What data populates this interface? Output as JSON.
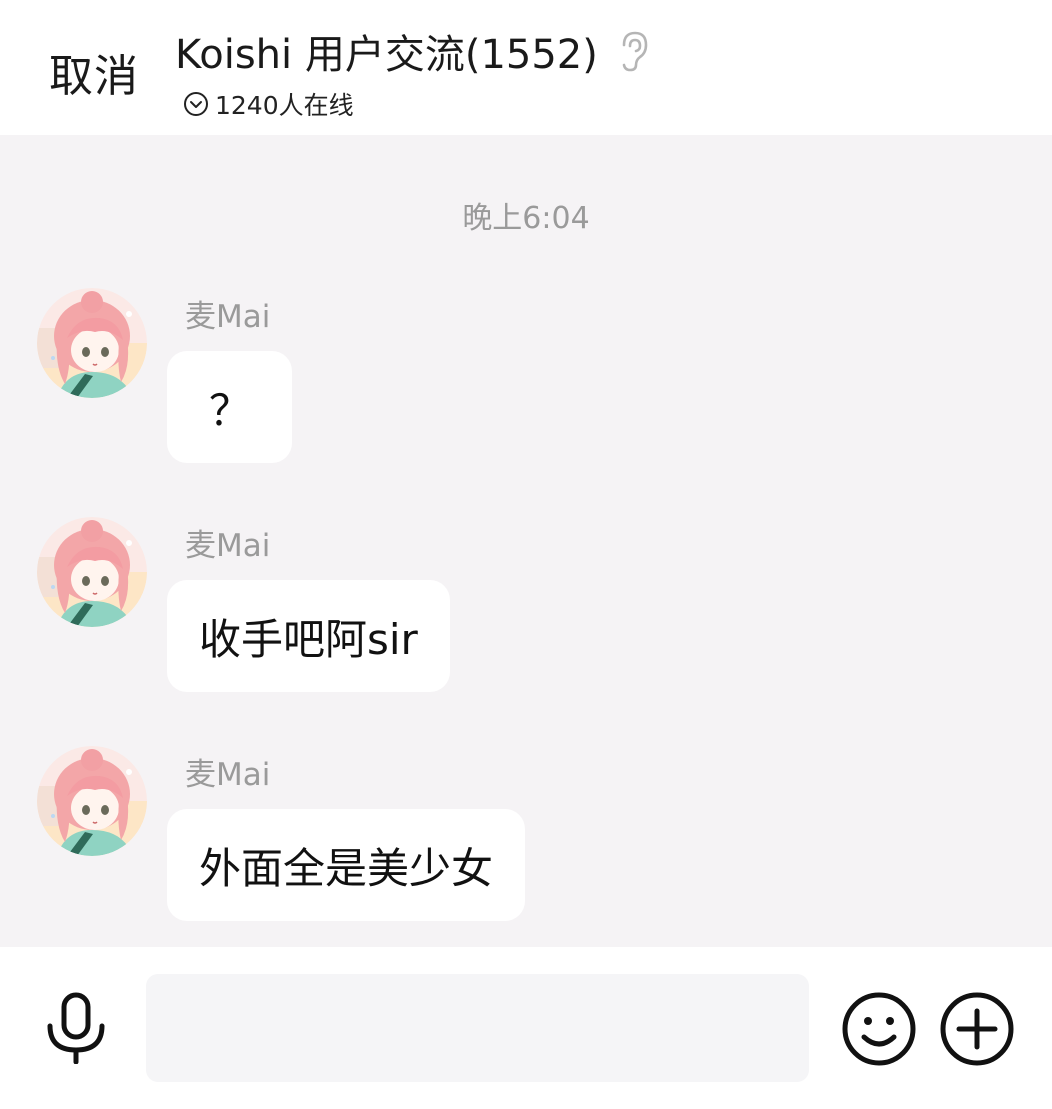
{
  "header": {
    "cancel_label": "取消",
    "title": "Koishi 用户交流(1552)",
    "online_text": "1240人在线"
  },
  "chat": {
    "timestamp": "晚上6:04",
    "messages": [
      {
        "sender": "麦Mai",
        "text": "？"
      },
      {
        "sender": "麦Mai",
        "text": "收手吧阿sir"
      },
      {
        "sender": "麦Mai",
        "text": "外面全是美少女"
      }
    ]
  },
  "input": {
    "value": "",
    "placeholder": ""
  },
  "icons": {
    "ear": "ear-icon",
    "online": "chevron-circle-icon",
    "mic": "microphone-icon",
    "emoji": "smiley-icon",
    "plus": "plus-circle-icon"
  },
  "colors": {
    "chat_background": "#f5f3f5",
    "bubble": "#ffffff",
    "secondary_text": "#9a9a9a",
    "input_background": "#f5f5f7"
  }
}
